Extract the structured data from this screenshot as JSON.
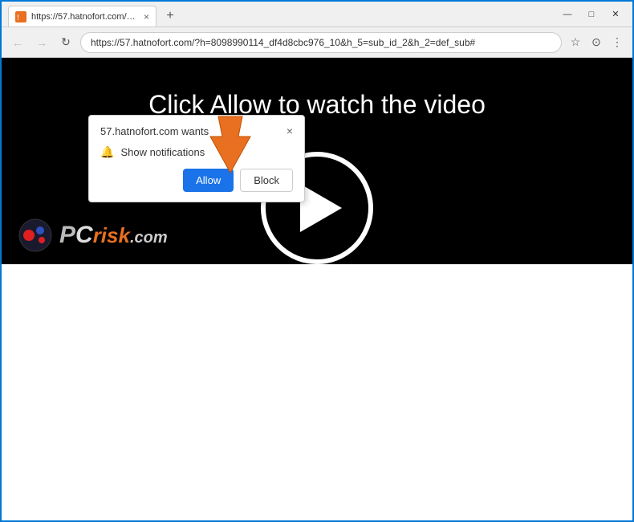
{
  "window": {
    "title": "https://57.hatnofort.com/?h=809...",
    "tab_label": "https://57.hatnofort.com/?h=809",
    "url": "https://57.hatnofort.com/?h=8098990114_df4d8cbc976_10&h_5=sub_id_2&h_2=def_sub#"
  },
  "nav": {
    "back": "←",
    "forward": "→",
    "refresh": "↻"
  },
  "popup": {
    "title": "57.hatnofort.com wants",
    "notification_label": "Show notifications",
    "allow_label": "Allow",
    "block_label": "Block",
    "close_label": "×"
  },
  "content": {
    "video_prompt": "Click Allow to watch the video"
  },
  "watermark": {
    "text": "PCrisk.com"
  }
}
